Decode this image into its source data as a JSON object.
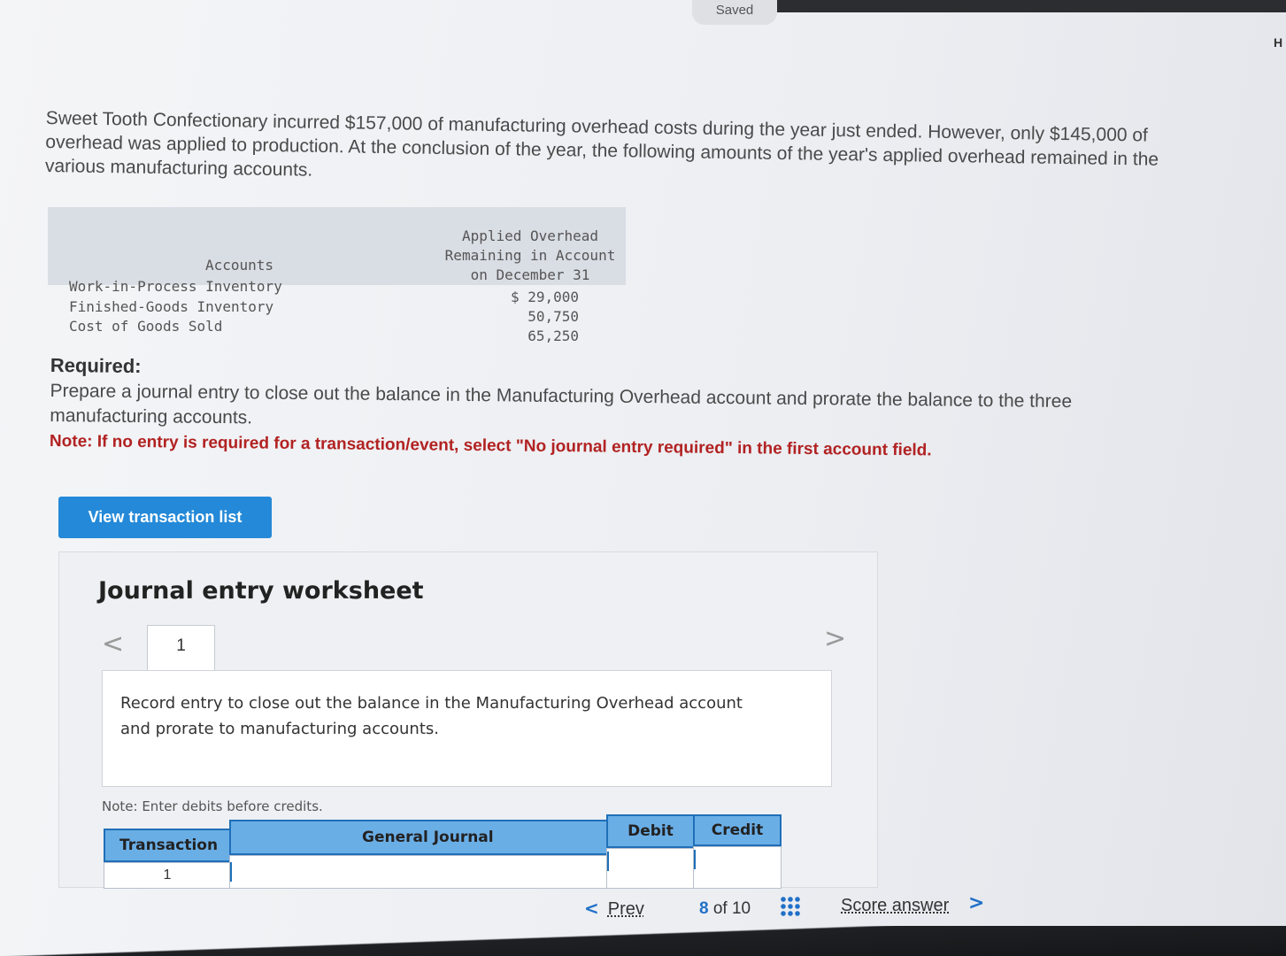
{
  "header": {
    "status": "Saved",
    "help_partial": "H"
  },
  "problem": {
    "intro": "Sweet Tooth Confectionary incurred $157,000 of manufacturing overhead costs during the year just ended. However, only $145,000 of overhead was applied to production. At the conclusion of the year, the following amounts of the year's applied overhead remained in the various manufacturing accounts.",
    "table": {
      "col_accounts": "Accounts",
      "col_overhead": "Applied Overhead Remaining in Account on December 31",
      "rows": [
        {
          "account": "Work-in-Process Inventory",
          "amount": "$ 29,000"
        },
        {
          "account": "Finished-Goods Inventory",
          "amount": "50,750"
        },
        {
          "account": "Cost of Goods Sold",
          "amount": "65,250"
        }
      ]
    },
    "required_label": "Required:",
    "required_text": "Prepare a journal entry to close out the balance in the Manufacturing Overhead account and prorate the balance to the three manufacturing accounts.",
    "note": "Note: If no entry is required for a transaction/event, select \"No journal entry required\" in the first account field."
  },
  "buttons": {
    "view_transaction_list": "View transaction list"
  },
  "worksheet": {
    "title": "Journal entry worksheet",
    "prev_chevron": "<",
    "next_chevron": ">",
    "tab": "1",
    "description": "Record entry to close out the balance in the Manufacturing Overhead account and prorate to manufacturing accounts.",
    "note": "Note: Enter debits before credits.",
    "columns": {
      "transaction": "Transaction",
      "general_journal": "General Journal",
      "debit": "Debit",
      "credit": "Credit"
    },
    "rows": [
      {
        "transaction": "1"
      }
    ]
  },
  "pager": {
    "prev_arrow": "<",
    "prev_label": "Prev",
    "current": "8",
    "of_label": "of 10",
    "score_label": "Score answer",
    "next_arrow": ">"
  },
  "colors": {
    "accent": "#2489d8",
    "note_red": "#b22222",
    "table_header": "#6aaee6"
  }
}
